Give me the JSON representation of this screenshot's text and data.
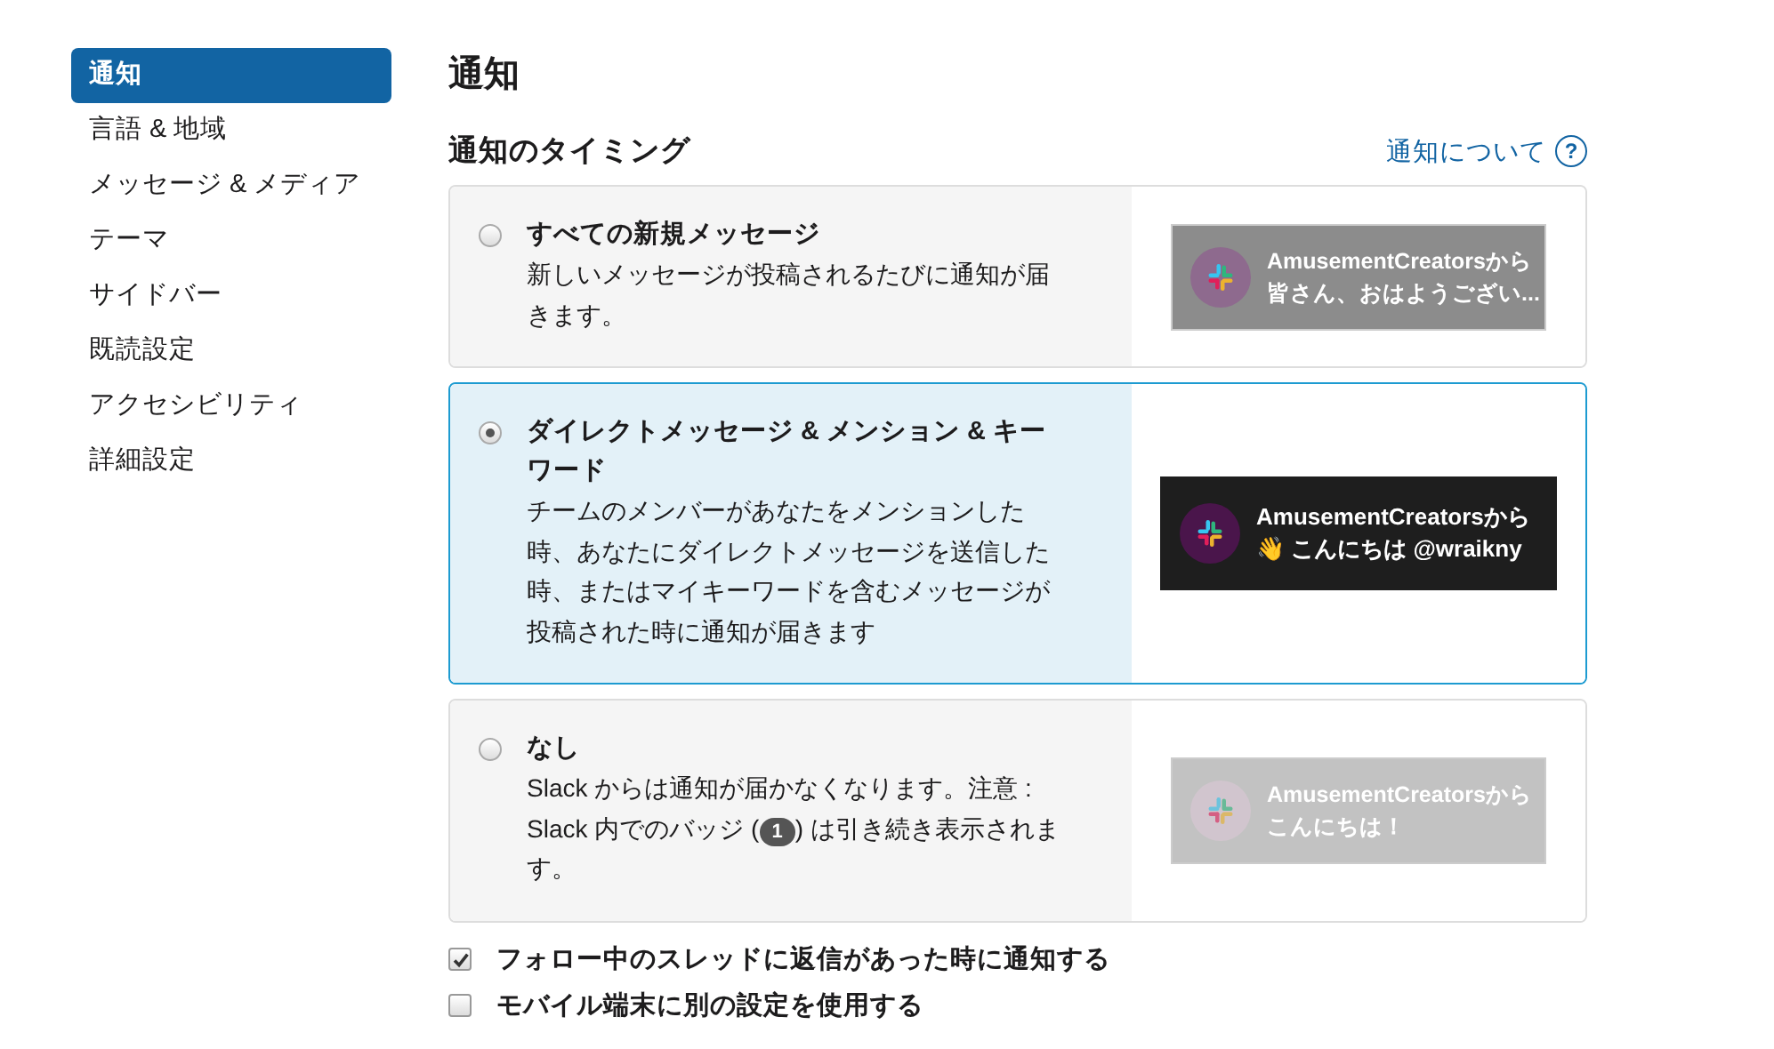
{
  "sidebar": {
    "items": [
      {
        "label": "通知",
        "selected": true
      },
      {
        "label": "言語 & 地域",
        "selected": false
      },
      {
        "label": "メッセージ & メディア",
        "selected": false
      },
      {
        "label": "テーマ",
        "selected": false
      },
      {
        "label": "サイドバー",
        "selected": false
      },
      {
        "label": "既読設定",
        "selected": false
      },
      {
        "label": "アクセシビリティ",
        "selected": false
      },
      {
        "label": "詳細設定",
        "selected": false
      }
    ]
  },
  "page_title": "通知",
  "section": {
    "heading": "通知のタイミング",
    "help_link": "通知について",
    "help_icon": "?"
  },
  "options": [
    {
      "title": "すべての新規メッセージ",
      "description": [
        {
          "kind": "text",
          "text": "新しいメッセージが投稿されるたびに通知が届きます。"
        }
      ],
      "selected": false,
      "preview": {
        "kind": "muted",
        "sender": "AmusementCreatorsから",
        "message": "皆さん、おはようござい..."
      }
    },
    {
      "title": "ダイレクトメッセージ & メンション & キーワード",
      "description": [
        {
          "kind": "text",
          "text": "チームのメンバーがあなたをメンションした時、あなたにダイレクトメッセージを送信した時、またはマイキーワードを含むメッセージが投稿された時に通知が届きます"
        }
      ],
      "selected": true,
      "preview": {
        "kind": "dark",
        "sender": "AmusementCreatorsから",
        "message": "👋 こんにちは @wraikny"
      }
    },
    {
      "title": "なし",
      "description": [
        {
          "kind": "text",
          "text": "Slack からは通知が届かなくなります。注意 : Slack 内でのバッジ ("
        },
        {
          "kind": "badge",
          "text": "1"
        },
        {
          "kind": "text",
          "text": ") は引き続き表示されます。"
        }
      ],
      "selected": false,
      "preview": {
        "kind": "faded",
        "sender": "AmusementCreatorsから",
        "message": "こんにちは！"
      }
    }
  ],
  "checkboxes": [
    {
      "label": "フォロー中のスレッドに返信があった時に通知する",
      "checked": true
    },
    {
      "label": "モバイル端末に別の設定を使用する",
      "checked": false
    }
  ]
}
